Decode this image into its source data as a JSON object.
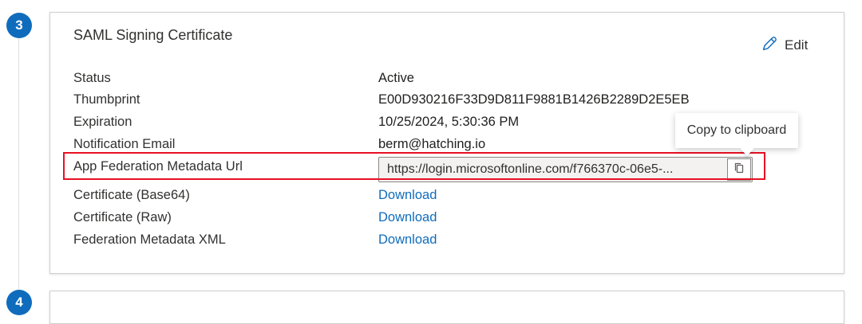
{
  "step": {
    "number": "3",
    "next_number": "4"
  },
  "card": {
    "title": "SAML Signing Certificate",
    "edit_label": "Edit",
    "rows": [
      {
        "label": "Status",
        "value": "Active"
      },
      {
        "label": "Thumbprint",
        "value": "E00D930216F33D9D811F9881B1426B2289D2E5EB"
      },
      {
        "label": "Expiration",
        "value": "10/25/2024, 5:30:36 PM"
      },
      {
        "label": "Notification Email",
        "value": "berm@hatching.io"
      },
      {
        "label": "App Federation Metadata Url",
        "value": "https://login.microsoftonline.com/f766370c-06e5-..."
      },
      {
        "label": "Certificate (Base64)",
        "value": "Download"
      },
      {
        "label": "Certificate (Raw)",
        "value": "Download"
      },
      {
        "label": "Federation Metadata XML",
        "value": "Download"
      }
    ]
  },
  "tooltip": {
    "text": "Copy to clipboard"
  },
  "icons": {
    "edit": "pencil-icon",
    "copy": "copy-icon"
  },
  "colors": {
    "accent": "#0f6cbd",
    "highlight": "#e81123"
  }
}
